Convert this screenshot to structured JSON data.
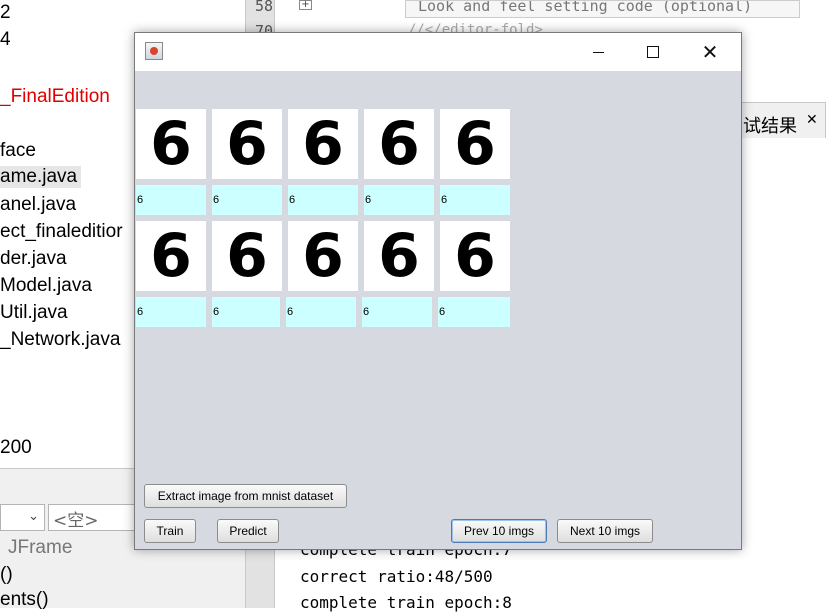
{
  "ide": {
    "tree_lines": [
      "2",
      "4",
      "_FinalEdition",
      "face",
      "ame.java",
      "anel.java",
      "ect_finaleditior",
      "der.java",
      "Model.java",
      "Util.java",
      "_Network.java",
      "200"
    ],
    "props": {
      "dropdown_value": "<空>",
      "type": "JFrame",
      "line1": "()",
      "line2": "ents()"
    },
    "line_numbers": [
      "58",
      "70"
    ],
    "code": {
      "line1": "Look and feel setting code (optional)",
      "line2": "//</editor-fold>"
    },
    "right_tab": "试结果",
    "output": [
      "complete train epoch:7",
      "correct ratio:48/500",
      "complete train epoch:8"
    ],
    "colors": {
      "red_project": "#e00000"
    }
  },
  "window": {
    "title": "",
    "digits_row1": [
      "6",
      "6",
      "6",
      "6",
      "6"
    ],
    "labels_row1": [
      "6",
      "6",
      "6",
      "6",
      "6"
    ],
    "digits_row2": [
      "6",
      "6",
      "6",
      "6",
      "6"
    ],
    "labels_row2": [
      "6",
      "6",
      "6",
      "6",
      "6"
    ],
    "buttons": {
      "extract": "Extract image from mnist dataset",
      "train": "Train",
      "predict": "Predict",
      "prev": "Prev 10 imgs",
      "next": "Next 10 imgs"
    },
    "colors": {
      "background": "#d6d9df",
      "label_bg": "#ccffff"
    }
  }
}
